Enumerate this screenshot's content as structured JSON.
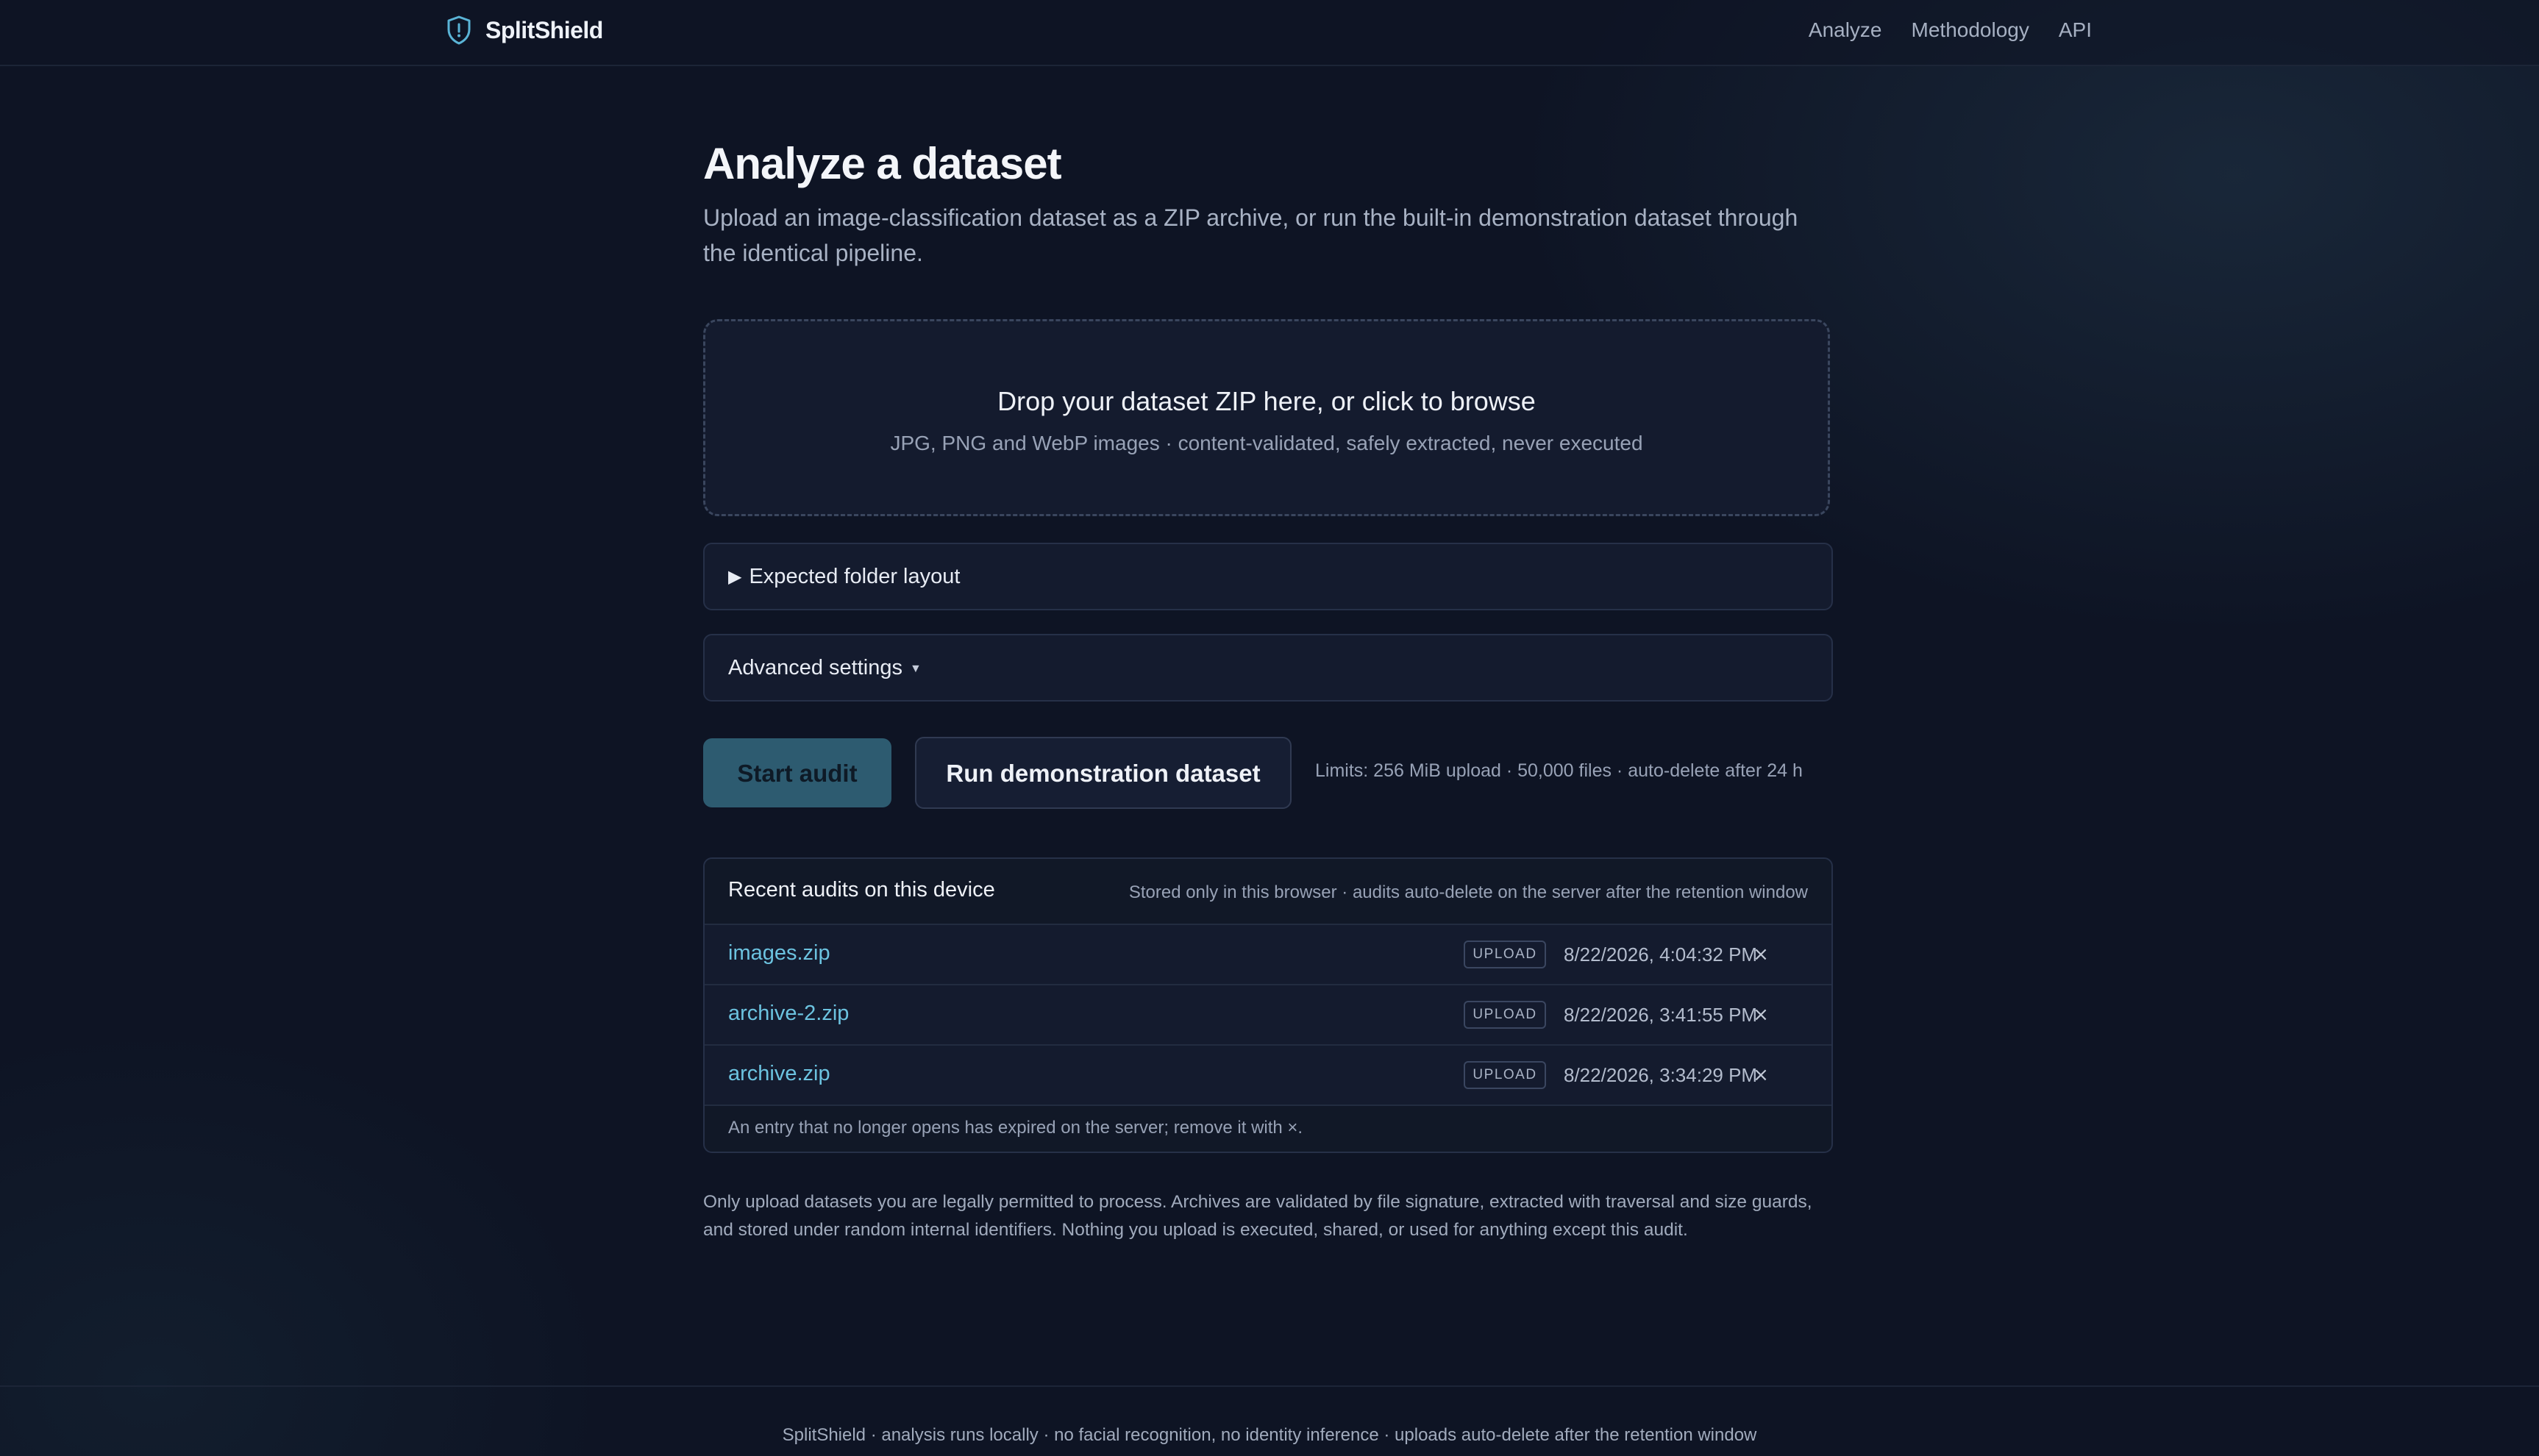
{
  "header": {
    "brand": "SplitShield",
    "nav": [
      "Analyze",
      "Methodology",
      "API"
    ]
  },
  "page": {
    "title": "Analyze a dataset",
    "description": "Upload an image-classification dataset as a ZIP archive, or run the built-in demonstration dataset through the identical pipeline."
  },
  "dropzone": {
    "title": "Drop your dataset ZIP here, or click to browse",
    "subtitle": "JPG, PNG and WebP images · content-validated, safely extracted, never executed"
  },
  "panels": {
    "folder_layout": "Expected folder layout",
    "advanced_settings": "Advanced settings"
  },
  "actions": {
    "start_audit": "Start audit",
    "run_demo": "Run demonstration dataset",
    "limits": "Limits: 256 MiB upload · 50,000 files · auto-delete after 24 h"
  },
  "recent": {
    "title": "Recent audits on this device",
    "note": "Stored only in this browser · audits auto-delete on the server after the retention window",
    "items": [
      {
        "name": "images.zip",
        "badge": "UPLOAD",
        "date": "8/22/2026, 4:04:32 PM",
        "remove": "×"
      },
      {
        "name": "archive-2.zip",
        "badge": "UPLOAD",
        "date": "8/22/2026, 3:41:55 PM",
        "remove": "×"
      },
      {
        "name": "archive.zip",
        "badge": "UPLOAD",
        "date": "8/22/2026, 3:34:29 PM",
        "remove": "×"
      }
    ],
    "footnote": "An entry that no longer opens has expired on the server; remove it with ×."
  },
  "legal": "Only upload datasets you are legally permitted to process. Archives are validated by file signature, extracted with traversal and size guards, and stored under random internal identifiers. Nothing you upload is executed, shared, or used for anything except this audit.",
  "footer": "SplitShield · analysis runs locally · no facial recognition, no identity inference · uploads auto-delete after the retention window",
  "colors": {
    "background": "#0e1424",
    "accent": "#6cc3e0",
    "primary_button": "#2d5b70"
  },
  "icons": {
    "brand": "shield-icon",
    "expand": "triangle-right-icon",
    "dropdown": "caret-down-icon",
    "remove": "close-icon"
  }
}
